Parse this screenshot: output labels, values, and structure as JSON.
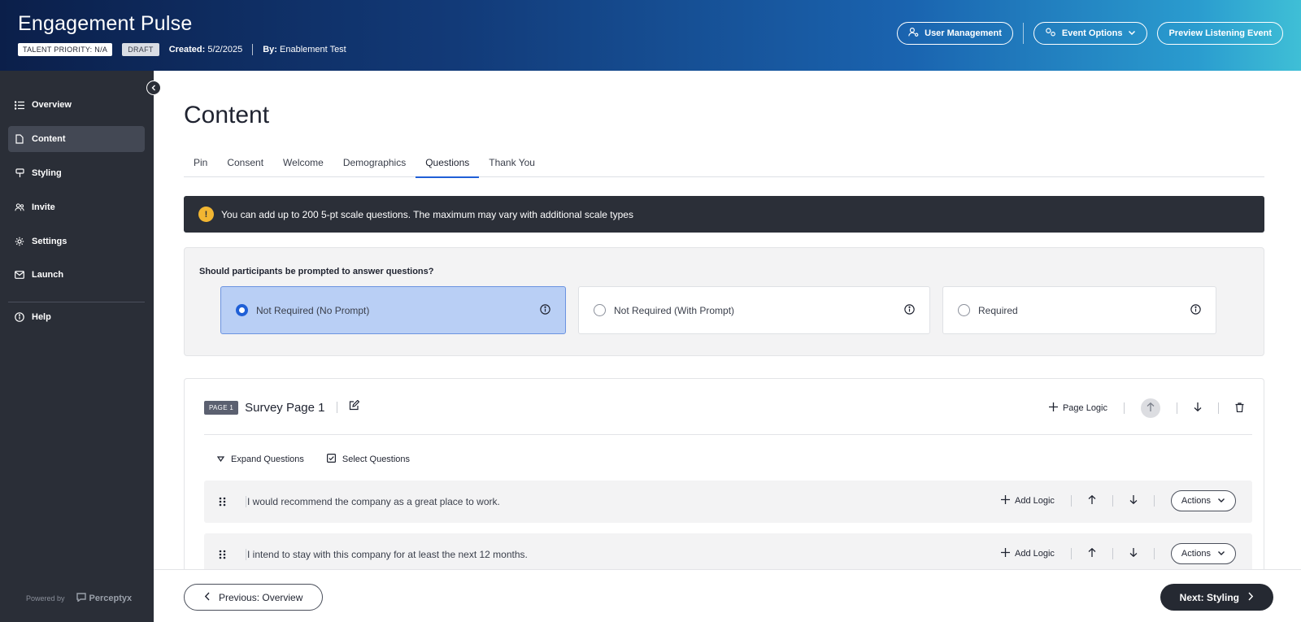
{
  "header": {
    "title": "Engagement Pulse",
    "talent_priority": "TALENT PRIORITY: N/A",
    "status": "DRAFT",
    "created_label": "Created:",
    "created_value": "5/2/2025",
    "by_label": "By:",
    "by_value": "Enablement Test",
    "buttons": {
      "user_management": "User Management",
      "event_options": "Event Options",
      "preview": "Preview Listening Event"
    }
  },
  "sidebar": {
    "items": [
      {
        "label": "Overview",
        "icon": "list-icon"
      },
      {
        "label": "Content",
        "icon": "document-icon"
      },
      {
        "label": "Styling",
        "icon": "brush-icon"
      },
      {
        "label": "Invite",
        "icon": "users-icon"
      },
      {
        "label": "Settings",
        "icon": "gear-icon"
      },
      {
        "label": "Launch",
        "icon": "envelope-icon"
      }
    ],
    "help": "Help",
    "powered_by": "Powered by",
    "brand": "Perceptyx"
  },
  "main": {
    "title": "Content",
    "tabs": [
      "Pin",
      "Consent",
      "Welcome",
      "Demographics",
      "Questions",
      "Thank You"
    ],
    "active_tab": "Questions",
    "notice": "You can add up to 200 5-pt scale questions. The maximum may vary with additional scale types",
    "prompt": {
      "question": "Should participants be prompted to answer questions?",
      "options": [
        "Not Required (No Prompt)",
        "Not Required (With Prompt)",
        "Required"
      ],
      "selected": "Not Required (No Prompt)"
    },
    "page": {
      "tag": "PAGE 1",
      "name": "Survey Page 1",
      "page_logic": "Page Logic",
      "expand_questions": "Expand Questions",
      "select_questions": "Select Questions",
      "questions": [
        {
          "text": "I would recommend the company as a great place to work.",
          "add_logic": "Add Logic",
          "actions": "Actions"
        },
        {
          "text": "I intend to stay with this company for at least the next 12 months.",
          "add_logic": "Add Logic",
          "actions": "Actions"
        }
      ]
    }
  },
  "footer": {
    "previous": "Previous: Overview",
    "next": "Next: Styling"
  },
  "colors": {
    "accent": "#1f5fd6",
    "sidebar_bg": "#2a2e37",
    "selected_option_bg": "#b9cff5",
    "warning": "#f2b632"
  }
}
